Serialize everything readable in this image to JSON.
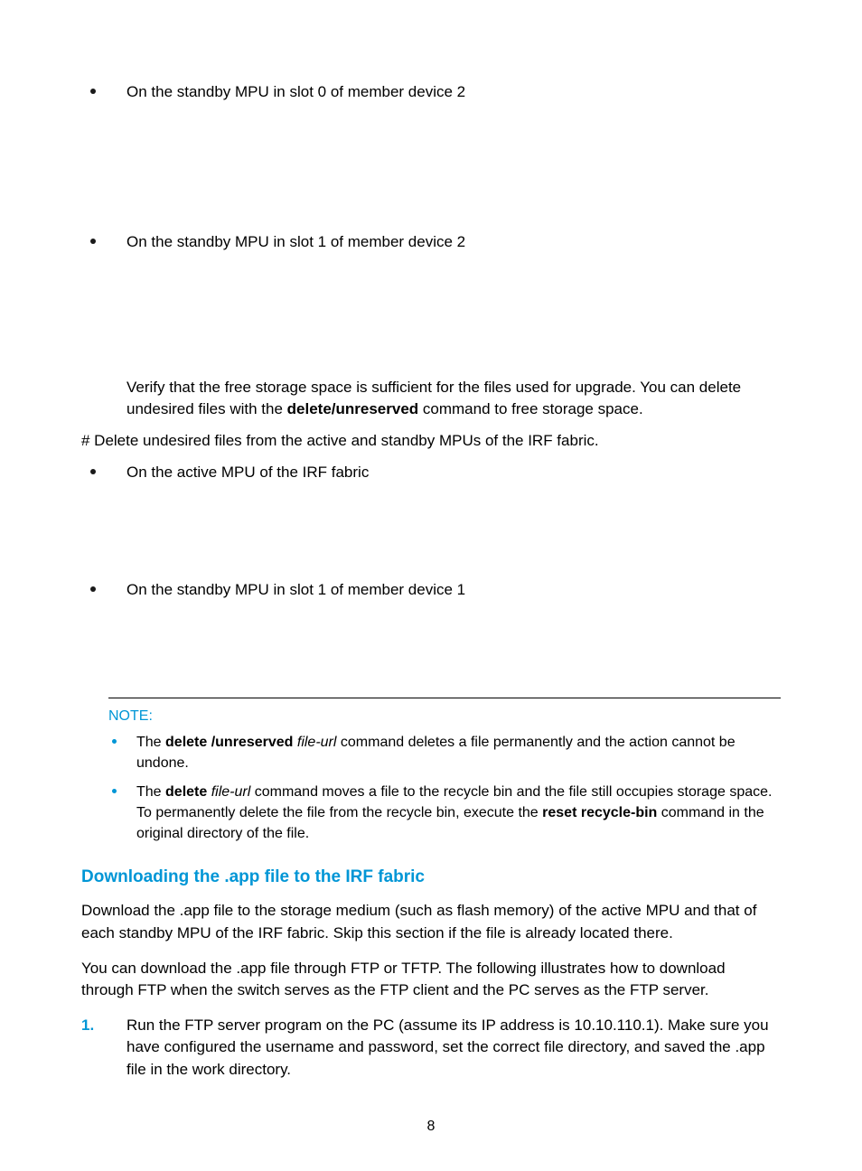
{
  "bullets": {
    "b1": "On the standby MPU in slot 0 of member device 2",
    "b2": "On the standby MPU in slot 1 of member device 2",
    "b3": "On the active MPU of the IRF fabric",
    "b4": "On the standby MPU in slot 1 of member device 1"
  },
  "verify": {
    "line1_pre": "Verify that the free storage space is sufficient for the files used for upgrade. You can delete undesired files with the ",
    "line1_bold": "delete/unreserved",
    "line1_post": " command to free storage space."
  },
  "hash_line": "# Delete undesired files from the active and standby MPUs of the IRF fabric.",
  "note": {
    "title": "NOTE:",
    "n1_pre": "The ",
    "n1_b1": "delete /unreserved",
    "n1_it": " file-url",
    "n1_post": " command deletes a file permanently and the action cannot be undone.",
    "n2_pre": "The ",
    "n2_b1": "delete",
    "n2_it": " file-url",
    "n2_mid": " command moves a file to the recycle bin and the file still occupies storage space. To permanently delete the file from the recycle bin, execute the ",
    "n2_b2": "reset recycle-bin",
    "n2_post": " command in the original directory of the file."
  },
  "heading": "Downloading the .app file to the IRF fabric",
  "download": {
    "p1": "Download the .app file to the storage medium (such as flash memory) of the active MPU and that of each standby MPU of the IRF fabric. Skip this section if the file is already located there.",
    "p2": "You can download the .app file through FTP or TFTP. The following illustrates how to download through FTP when the switch serves as the FTP client and the PC serves as the FTP server."
  },
  "step1": {
    "num": "1.",
    "text": "Run the FTP server program on the PC (assume its IP address is 10.10.110.1). Make sure you have configured the username and password, set the correct file directory, and saved the .app file in the work directory."
  },
  "page_number": "8"
}
